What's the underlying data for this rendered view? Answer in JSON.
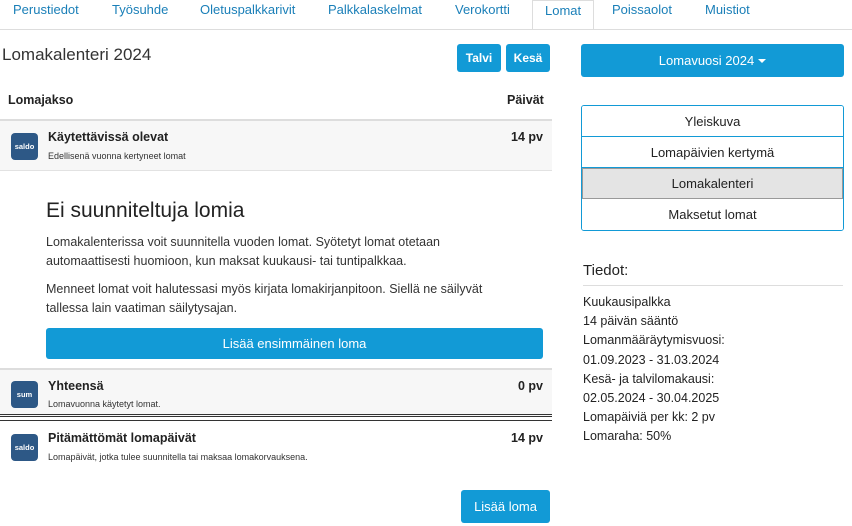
{
  "tabs": [
    "Perustiedot",
    "Työsuhde",
    "Oletuspalkkarivit",
    "Palkkalaskelmat",
    "Verokortti",
    "Lomat",
    "Poissaolot",
    "Muistiot"
  ],
  "calendar": {
    "title": "Lomakalenteri 2024",
    "btn_winter": "Talvi",
    "btn_summer": "Kesä",
    "col_period": "Lomajakso",
    "col_days": "Päivät"
  },
  "rows": {
    "available": {
      "badge": "saldo",
      "title": "Käytettävissä olevat",
      "sub": "Edellisenä vuonna kertyneet lomat",
      "value": "14 pv"
    },
    "total": {
      "badge": "sum",
      "title": "Yhteensä",
      "sub": "Lomavuonna käytetyt lomat.",
      "value": "0 pv"
    },
    "unused": {
      "badge": "saldo",
      "title": "Pitämättömät lomapäivät",
      "sub": "Lomapäivät, jotka tulee suunnitella tai maksaa lomakorvauksena.",
      "value": "14 pv"
    }
  },
  "empty": {
    "heading": "Ei suunniteltuja lomia",
    "p1": "Lomakalenterissa voit suunnitella vuoden lomat. Syötetyt lomat otetaan automaattisesti huomioon, kun maksat kuukausi- tai tuntipalkkaa.",
    "p2": "Menneet lomat voit halutessasi myös kirjata lomakirjanpitoon. Siellä ne säilyvät tallessa lain vaatiman säilytysajan.",
    "add_first": "Lisää ensimmäinen loma"
  },
  "add_button": "Lisää loma",
  "sidebar": {
    "year_button": "Lomavuosi 2024",
    "nav": [
      "Yleiskuva",
      "Lomapäivien kertymä",
      "Lomakalenteri",
      "Maksetut lomat"
    ],
    "info_title": "Tiedot:",
    "info": [
      "Kuukausipalkka",
      "14 päivän sääntö",
      "Lomanmääräytymisvuosi:",
      "01.09.2023 - 31.03.2024",
      "Kesä- ja talvilomakausi:",
      "02.05.2024 - 30.04.2025",
      "Lomapäiviä per kk: 2 pv",
      "Lomaraha: 50%"
    ]
  },
  "colors": {
    "accent": "#129ad6",
    "badge": "#2d5886"
  }
}
